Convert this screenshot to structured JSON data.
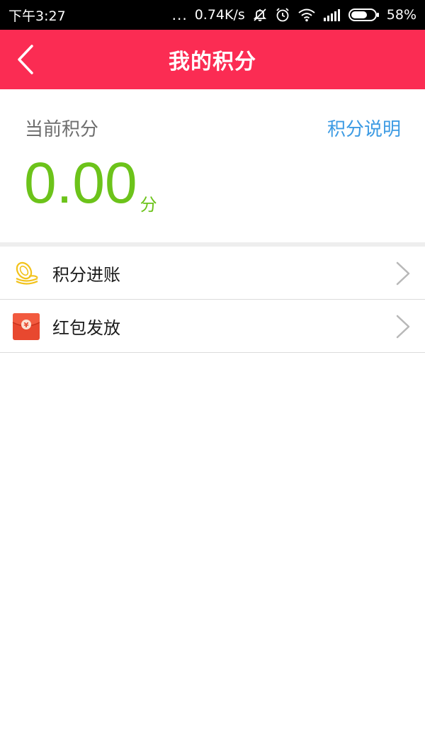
{
  "status_bar": {
    "time": "下午3:27",
    "dots": "...",
    "speed": "0.74K/s",
    "battery": "58%"
  },
  "header": {
    "title": "我的积分",
    "bg_color": "#fb2c53"
  },
  "points": {
    "label": "当前积分",
    "explain_link": "积分说明",
    "value": "0.00",
    "unit": "分",
    "value_color": "#6cc31a",
    "link_color": "#3d9be3"
  },
  "menu": {
    "items": [
      {
        "label": "积分进账",
        "icon": "coins-icon"
      },
      {
        "label": "红包发放",
        "icon": "red-envelope-icon"
      }
    ]
  }
}
